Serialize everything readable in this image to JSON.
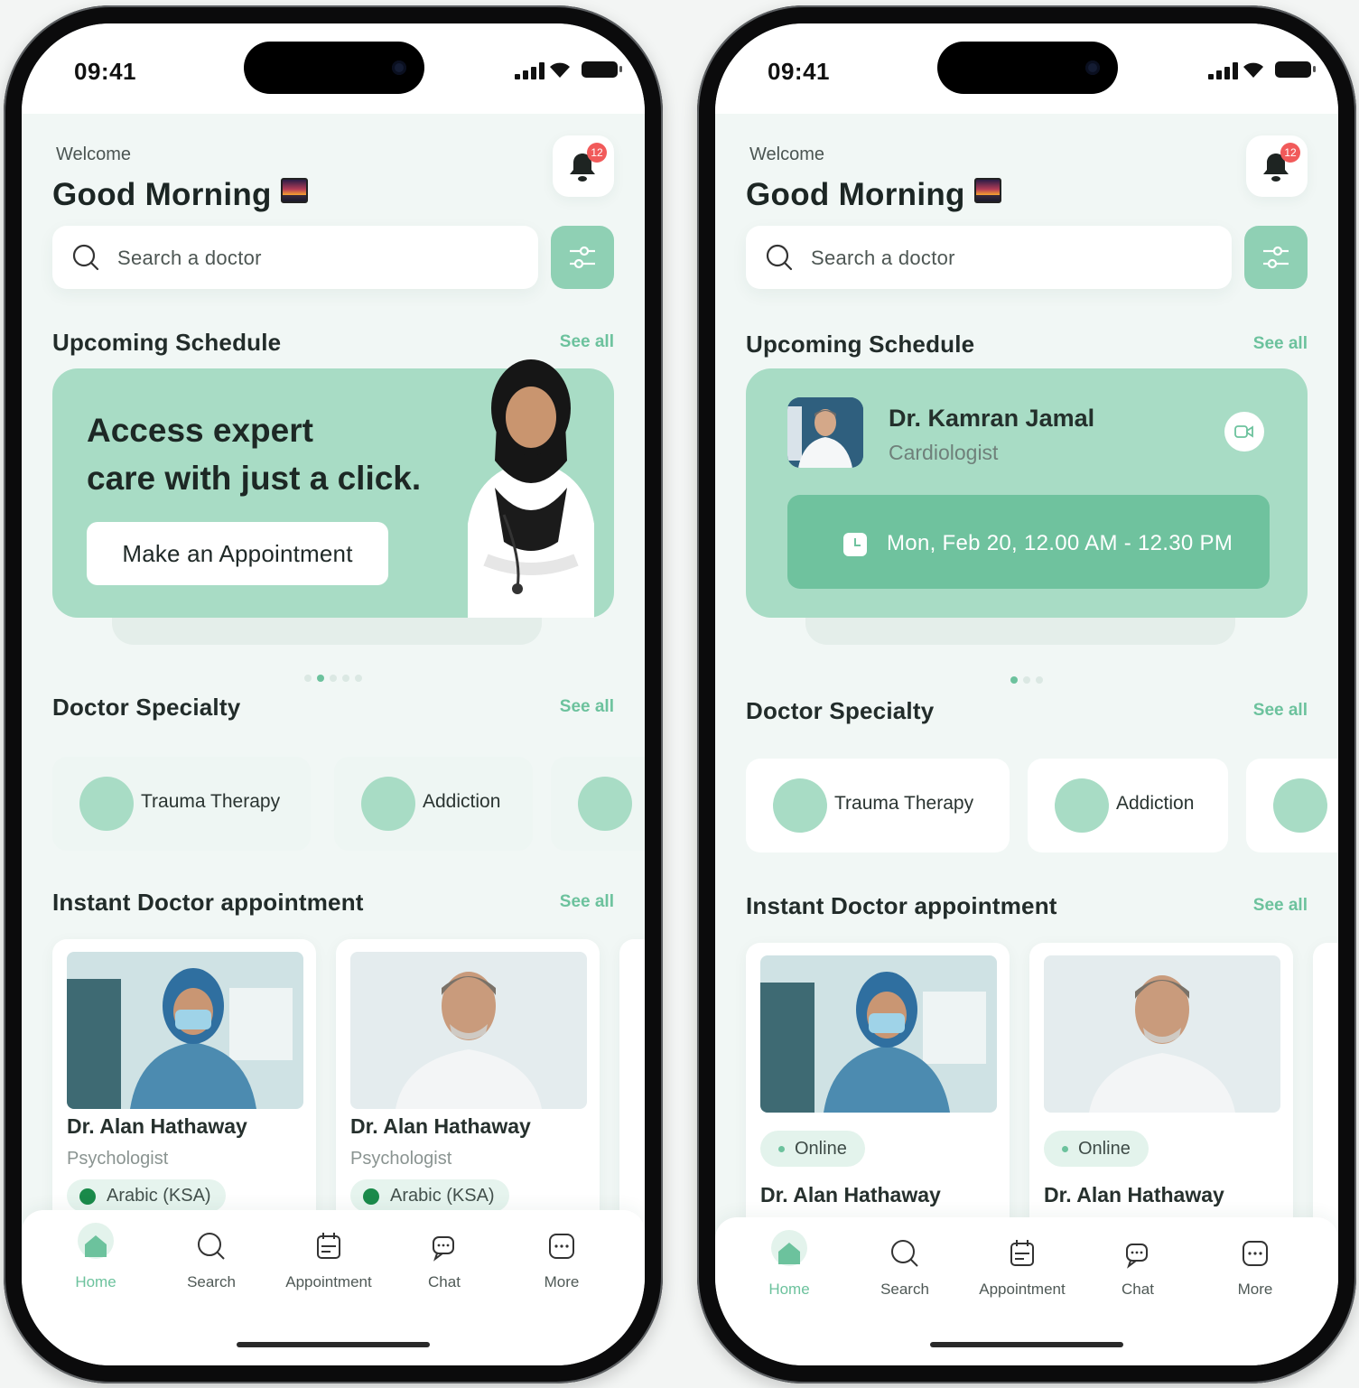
{
  "status": {
    "time": "09:41"
  },
  "header": {
    "welcome": "Welcome",
    "greeting": "Good Morning",
    "notification_count": "12"
  },
  "search": {
    "placeholder": "Search a doctor"
  },
  "sections": {
    "upcoming": "Upcoming Schedule",
    "specialty": "Doctor Specialty",
    "instant": "Instant Doctor appointment",
    "see_all": "See all"
  },
  "banner": {
    "headline_line1": "Access expert",
    "headline_line2": "care with just a click.",
    "button": "Make an Appointment"
  },
  "schedule": {
    "doctor": "Dr. Kamran Jamal",
    "specialty": "Cardiologist",
    "time": "Mon, Feb 20, 12.00 AM - 12.30 PM"
  },
  "specialties": [
    {
      "label": "Trauma Therapy"
    },
    {
      "label": "Addiction"
    }
  ],
  "doctors": [
    {
      "name": "Dr. Alan Hathaway",
      "specialty": "Psychologist",
      "language": "Arabic (KSA)",
      "status": "Online"
    },
    {
      "name": "Dr. Alan Hathaway",
      "specialty": "Psychologist",
      "language": "Arabic (KSA)",
      "status": "Online"
    }
  ],
  "tabs": [
    {
      "label": "Home",
      "icon": "home-icon"
    },
    {
      "label": "Search",
      "icon": "search-icon"
    },
    {
      "label": "Appointment",
      "icon": "calendar-icon"
    },
    {
      "label": "Chat",
      "icon": "chat-icon"
    },
    {
      "label": "More",
      "icon": "more-icon"
    }
  ],
  "colors": {
    "accent": "#6cc29d",
    "card": "#a8dcc5",
    "badge": "#f15a5a"
  }
}
